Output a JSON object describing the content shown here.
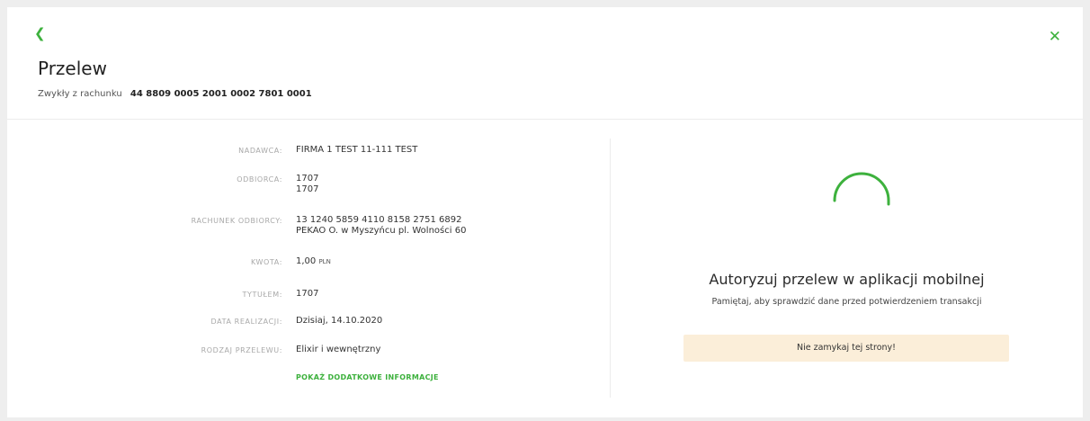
{
  "header": {
    "back_icon": "chevron-left-icon",
    "close_icon": "close-icon",
    "title": "Przelew",
    "subtitle_label": "Zwykły z rachunku",
    "account_number": "44 8809 0005 2001 0002 7801 0001"
  },
  "details": {
    "sender_label": "NADAWCA:",
    "sender_value": "FIRMA 1 TEST 11-111 TEST",
    "recipient_label": "ODBIORCA:",
    "recipient_line1": "1707",
    "recipient_line2": "1707",
    "recipient_account_label": "RACHUNEK ODBIORCY:",
    "recipient_account_line1": "13 1240 5859 4110 8158 2751 6892",
    "recipient_account_line2": "PEKAO O. w Myszyńcu  pl. Wolności 60",
    "amount_label": "KWOTA:",
    "amount_value": "1,00",
    "amount_currency": "PLN",
    "title_label": "TYTUŁEM:",
    "title_value": "1707",
    "date_label": "DATA REALIZACJI:",
    "date_value": "Dzisiaj, 14.10.2020",
    "type_label": "RODZAJ PRZELEWU:",
    "type_value": "Elixir i wewnętrzny",
    "more_link": "POKAŻ DODATKOWE INFORMACJE"
  },
  "auth": {
    "spinner_icon": "loading-spinner-icon",
    "title": "Autoryzuj przelew w aplikacji mobilnej",
    "subtitle": "Pamiętaj, aby sprawdzić dane przed potwierdzeniem transakcji",
    "warning": "Nie zamykaj tej strony!"
  },
  "colors": {
    "accent": "#3db13d",
    "warning_bg": "#fbeed9"
  }
}
